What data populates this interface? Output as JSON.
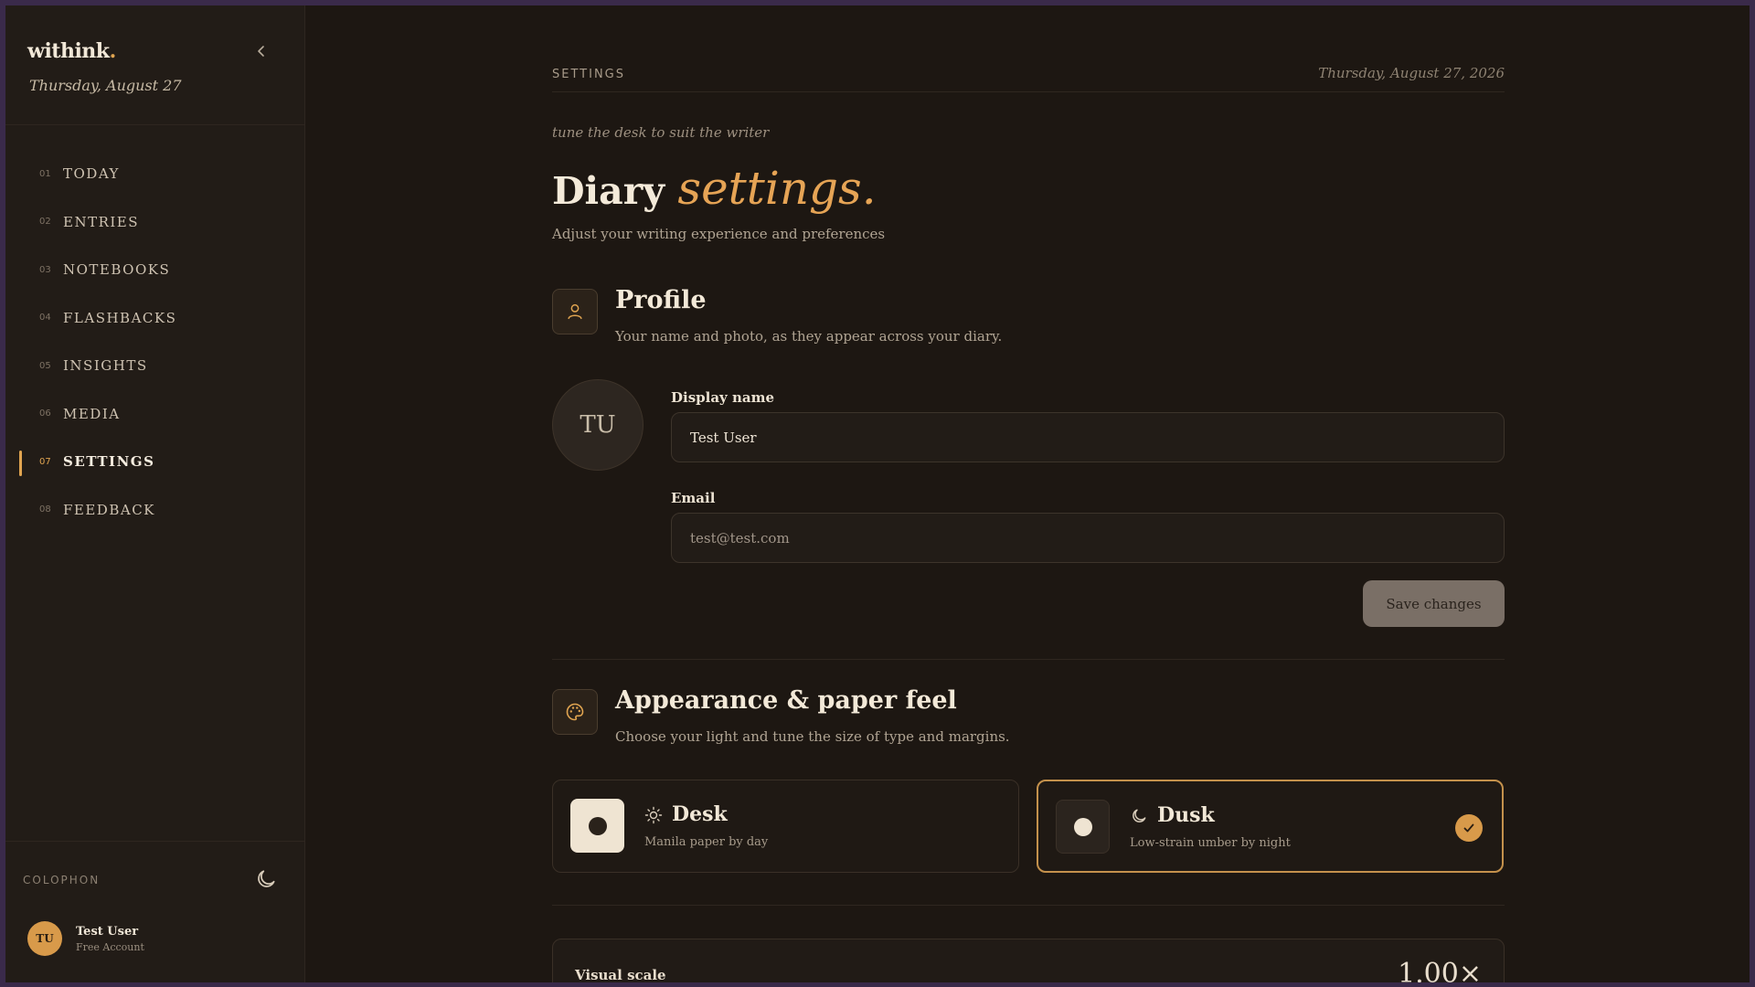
{
  "sidebar": {
    "brand": "withink",
    "brand_dot": ".",
    "collapse_icon": "chevron-left-icon",
    "date": "Thursday, August 27",
    "nav": [
      {
        "num": "01",
        "label": "TODAY"
      },
      {
        "num": "02",
        "label": "ENTRIES"
      },
      {
        "num": "03",
        "label": "NOTEBOOKS"
      },
      {
        "num": "04",
        "label": "FLASHBACKS"
      },
      {
        "num": "05",
        "label": "INSIGHTS"
      },
      {
        "num": "06",
        "label": "MEDIA"
      },
      {
        "num": "07",
        "label": "SETTINGS",
        "active": true
      },
      {
        "num": "08",
        "label": "FEEDBACK"
      }
    ],
    "colophon_label": "COLOPHON",
    "theme_toggle_icon": "moon-icon",
    "user": {
      "initials": "TU",
      "name": "Test User",
      "plan": "Free Account"
    }
  },
  "header": {
    "breadcrumb": "SETTINGS",
    "date": "Thursday, August 27, 2026",
    "tagline": "tune the desk to suit the writer",
    "title_main": "Diary",
    "title_accent": "settings.",
    "subtitle": "Adjust your writing experience and preferences"
  },
  "profile": {
    "icon": "user-icon",
    "title": "Profile",
    "description": "Your name and photo, as they appear across your diary.",
    "avatar_initials": "TU",
    "display_name_label": "Display name",
    "display_name_value": "Test User",
    "email_label": "Email",
    "email_value": "test@test.com",
    "save_label": "Save changes"
  },
  "appearance": {
    "icon": "palette-icon",
    "title": "Appearance & paper feel",
    "description": "Choose your light and tune the size of type and margins.",
    "themes": [
      {
        "name": "Desk",
        "description": "Manila paper by day",
        "icon": "sun-icon",
        "selected": false
      },
      {
        "name": "Dusk",
        "description": "Low-strain umber by night",
        "icon": "moon-icon",
        "selected": true
      }
    ],
    "visual_scale_label": "Visual scale",
    "visual_scale_value": "1.00×"
  },
  "colors": {
    "accent": "#e0a450",
    "background": "#1d1712",
    "sidebar": "#221c17"
  }
}
